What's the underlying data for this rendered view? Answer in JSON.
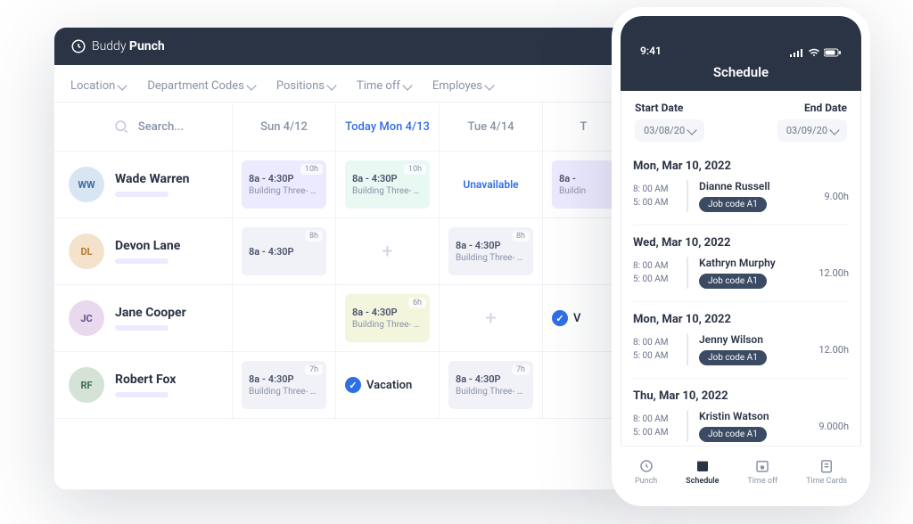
{
  "brand": {
    "name_light": "Buddy",
    "name_bold": "Punch"
  },
  "filters": [
    {
      "label": "Location"
    },
    {
      "label": "Department Codes"
    },
    {
      "label": "Positions"
    },
    {
      "label": "Time off"
    },
    {
      "label": "Employes"
    }
  ],
  "search_placeholder": "Search...",
  "columns": [
    {
      "label": "Sun 4/12",
      "today": false
    },
    {
      "label": "Today Mon 4/13",
      "today": true
    },
    {
      "label": "Tue 4/14",
      "today": false
    },
    {
      "label": "T",
      "today": false
    }
  ],
  "employees": [
    {
      "name": "Wade Warren",
      "avatar_bg": "#d8e5f2",
      "avatar_fg": "#3d6ea8",
      "initials": "WW"
    },
    {
      "name": "Devon Lane",
      "avatar_bg": "#f5e2cc",
      "avatar_fg": "#b47a32",
      "initials": "DL"
    },
    {
      "name": "Jane Cooper",
      "avatar_bg": "#e8d9ef",
      "avatar_fg": "#6b4a82",
      "initials": "JC"
    },
    {
      "name": "Robert Fox",
      "avatar_bg": "#d4e2d8",
      "avatar_fg": "#3e6c4d",
      "initials": "RF"
    }
  ],
  "schedule": [
    [
      {
        "type": "shift",
        "time": "8a - 4:30P",
        "loc": "Building Three- Day",
        "hours": "10h",
        "bg": "lav"
      },
      {
        "type": "shift",
        "time": "8a - 4:30P",
        "loc": "Building Three- Day",
        "hours": "10h",
        "bg": "mint"
      },
      {
        "type": "unavailable",
        "label": "Unavailable"
      },
      {
        "type": "shift_cut",
        "time": "8a -",
        "loc": "Buildin",
        "bg": "lav"
      }
    ],
    [
      {
        "type": "shift",
        "time": "8a - 4:30P",
        "loc": "",
        "hours": "8h",
        "bg": "grey"
      },
      {
        "type": "add"
      },
      {
        "type": "shift",
        "time": "8a - 4:30P",
        "loc": "Building Three- Day",
        "hours": "8h",
        "bg": "grey"
      },
      {
        "type": "empty"
      }
    ],
    [
      {
        "type": "empty"
      },
      {
        "type": "shift",
        "time": "8a - 4:30P",
        "loc": "Building Three- Day",
        "hours": "6h",
        "bg": "olive"
      },
      {
        "type": "add"
      },
      {
        "type": "vacation_cut",
        "label": "V"
      }
    ],
    [
      {
        "type": "shift",
        "time": "8a - 4:30P",
        "loc": "Building Three- Day",
        "hours": "7h",
        "bg": "grey"
      },
      {
        "type": "vacation",
        "label": "Vacation"
      },
      {
        "type": "shift",
        "time": "8a - 4:30P",
        "loc": "Building Three- Day",
        "hours": "7h",
        "bg": "grey"
      },
      {
        "type": "empty"
      }
    ]
  ],
  "phone": {
    "status_time": "9:41",
    "title": "Schedule",
    "start_label": "Start Date",
    "end_label": "End Date",
    "start_date": "03/08/20",
    "end_date": "03/09/20",
    "days": [
      {
        "header": "Mon, Mar 10, 2022",
        "start": "8: 00 AM",
        "end": "5: 00 AM",
        "name": "Dianne Russell",
        "job": "Job code A1",
        "hours": "9.00h"
      },
      {
        "header": "Wed, Mar 10, 2022",
        "start": "8: 00 AM",
        "end": "5: 00 AM",
        "name": "Kathryn Murphy",
        "job": "Job code A1",
        "hours": "12.00h"
      },
      {
        "header": "Mon, Mar 10, 2022",
        "start": "8: 00 AM",
        "end": "5: 00 AM",
        "name": "Jenny Wilson",
        "job": "Job code A1",
        "hours": "12.00h"
      },
      {
        "header": "Thu, Mar 10, 2022",
        "start": "8: 00 AM",
        "end": "5: 00 AM",
        "name": "Kristin Watson",
        "job": "Job code A1",
        "hours": "9.000h"
      }
    ],
    "nav": [
      {
        "label": "Punch"
      },
      {
        "label": "Schedule"
      },
      {
        "label": "Time off"
      },
      {
        "label": "Time Cards"
      }
    ]
  }
}
